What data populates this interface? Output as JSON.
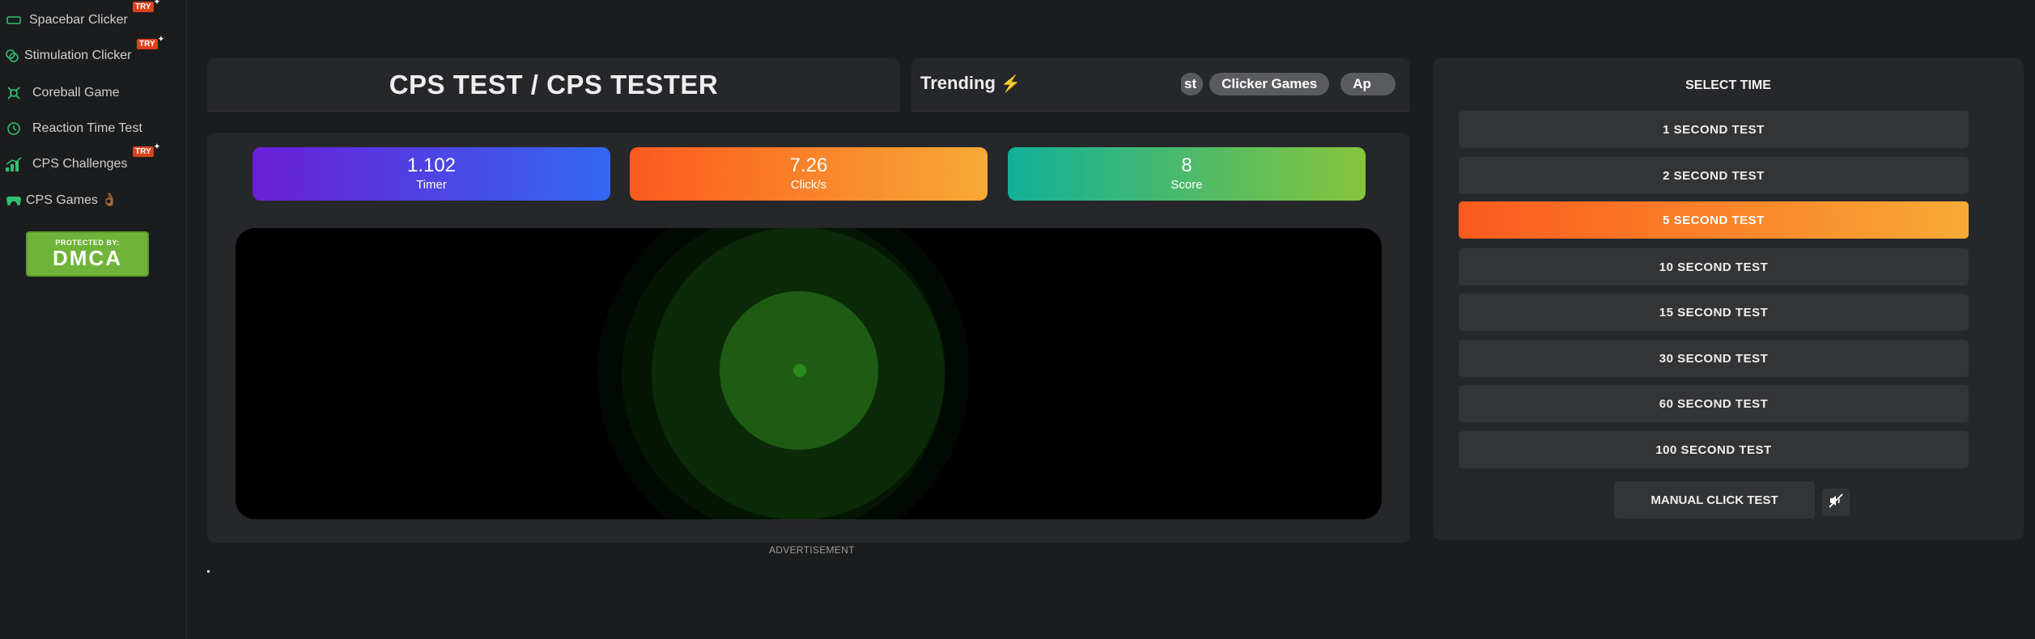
{
  "sidebar": {
    "items": [
      {
        "label": "Spacebar Clicker",
        "icon": "keyboard-icon",
        "try": "TRY"
      },
      {
        "label": "Stimulation Clicker",
        "icon": "clicker-icon",
        "try": "TRY"
      },
      {
        "label": "Coreball Game",
        "icon": "coreball-icon"
      },
      {
        "label": "Reaction Time Test",
        "icon": "clock-icon"
      },
      {
        "label": "CPS Challenges",
        "icon": "chart-icon",
        "try": "TRY"
      },
      {
        "label": "CPS Games 👌🏾",
        "icon": "gamepad-icon"
      }
    ],
    "dmca": {
      "top": "PROTECTED BY:",
      "bottom": "DMCA"
    }
  },
  "header": {
    "title": "CPS TEST / CPS TESTER"
  },
  "trending": {
    "label": "Trending",
    "icon": "fire-icon",
    "chips": [
      "st",
      "Clicker Games",
      "Ap"
    ]
  },
  "stats": {
    "timer": {
      "value": "1.102",
      "label": "Timer"
    },
    "cps": {
      "value": "7.26",
      "label": "Click/s"
    },
    "score": {
      "value": "8",
      "label": "Score"
    }
  },
  "ad_label": "ADVERTISEMENT",
  "time_select": {
    "title": "SELECT TIME",
    "options": [
      "1 SECOND TEST",
      "2 SECOND TEST",
      "5 SECOND TEST",
      "10 SECOND TEST",
      "15 SECOND TEST",
      "30 SECOND TEST",
      "60 SECOND TEST",
      "100 SECOND TEST"
    ],
    "selected": "5 SECOND TEST",
    "manual_label": "MANUAL CLICK TEST",
    "sound_icon": "mute-icon"
  },
  "colors": {
    "accent_orange": "#fd5a1e",
    "accent_yellow": "#f7aa35",
    "timer_purple": "#6a1fd6",
    "timer_blue": "#3368f2",
    "score_teal": "#12b09a",
    "score_green": "#86c53c",
    "ripple_green": "#1e6b12"
  }
}
